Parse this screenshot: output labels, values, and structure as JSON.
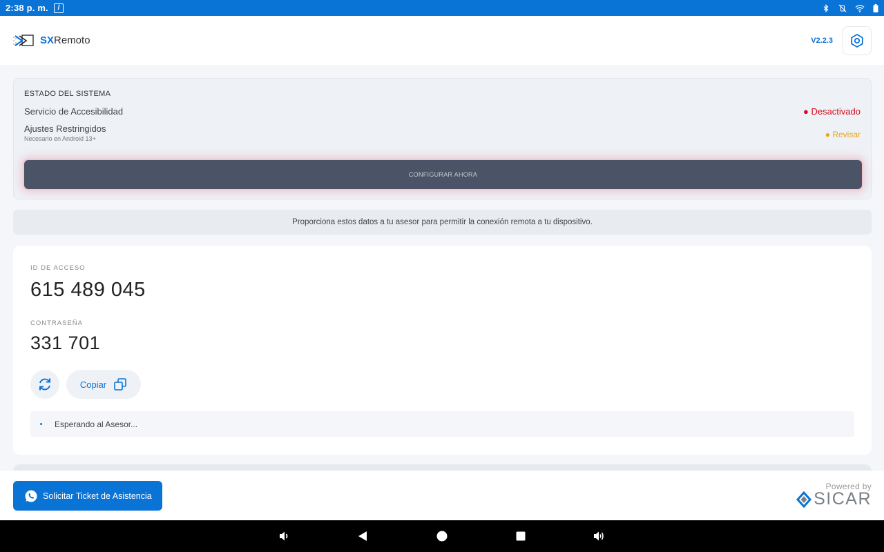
{
  "statusbar": {
    "time": "2:38 p. m.",
    "notif_glyph": "/",
    "icons": [
      "bluetooth-icon",
      "vibrate-off-icon",
      "wifi-icon",
      "battery-icon"
    ]
  },
  "header": {
    "brand_sx": "SX",
    "brand_rest": "Remoto",
    "version": "V2.2.3"
  },
  "system": {
    "title": "ESTADO DEL SISTEMA",
    "accessibility_label": "Servicio de Accesibilidad",
    "accessibility_status": "● Desactivado",
    "restricted_label": "Ajustes Restringidos",
    "restricted_sub": "Necesario en Android 13+",
    "restricted_status": "● Revisar",
    "configure_label": "CONFIGURAR AHORA"
  },
  "info": {
    "text": "Proporciona estos datos a tu asesor para permitir la conexión remota a tu dispositivo."
  },
  "credentials": {
    "id_label": "ID DE ACCESO",
    "id_value": "615 489 045",
    "password_label": "CONTRASEÑA",
    "password_value": "331 701",
    "copy_label": "Copiar",
    "waiting_text": "Esperando al Asesor..."
  },
  "footer": {
    "ticket_label": "Solicitar Ticket de Asistencia",
    "powered_by": "Powered by",
    "brand": "SICAR"
  },
  "colors": {
    "primary": "#0a73d6",
    "danger": "#d60d1b",
    "warning": "#e8a317",
    "button_dark": "#4a5466"
  }
}
